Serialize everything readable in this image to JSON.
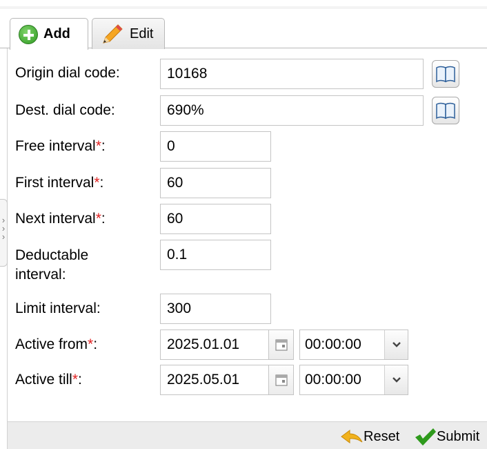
{
  "tabs": [
    {
      "label": "Add",
      "icon": "plus-circle-icon",
      "active": true
    },
    {
      "label": "Edit",
      "icon": "pencil-icon",
      "active": false
    }
  ],
  "form": {
    "origin_dial_code": {
      "label": "Origin dial code:",
      "value": "10168"
    },
    "dest_dial_code": {
      "label": "Dest. dial code:",
      "value": "690%"
    },
    "free_interval": {
      "label": "Free interval",
      "required_mark": "*",
      "suffix": ":",
      "value": "0"
    },
    "first_interval": {
      "label": "First interval",
      "required_mark": "*",
      "suffix": ":",
      "value": "60"
    },
    "next_interval": {
      "label": "Next interval",
      "required_mark": "*",
      "suffix": ":",
      "value": "60"
    },
    "deductable_interval": {
      "label_line1": "Deductable",
      "label_line2": "interval:",
      "value": "0.1"
    },
    "limit_interval": {
      "label": "Limit interval:",
      "value": "300"
    },
    "active_from": {
      "label": "Active from",
      "required_mark": "*",
      "suffix": ":",
      "date": "2025.01.01",
      "time": "00:00:00"
    },
    "active_till": {
      "label": "Active till",
      "required_mark": "*",
      "suffix": ":",
      "date": "2025.05.01",
      "time": "00:00:00"
    }
  },
  "footer": {
    "reset_label": "Reset",
    "submit_label": "Submit"
  },
  "colors": {
    "required": "#e02020",
    "submit_check": "#2e9a1c",
    "reset_arrow": "#f1b21d"
  }
}
